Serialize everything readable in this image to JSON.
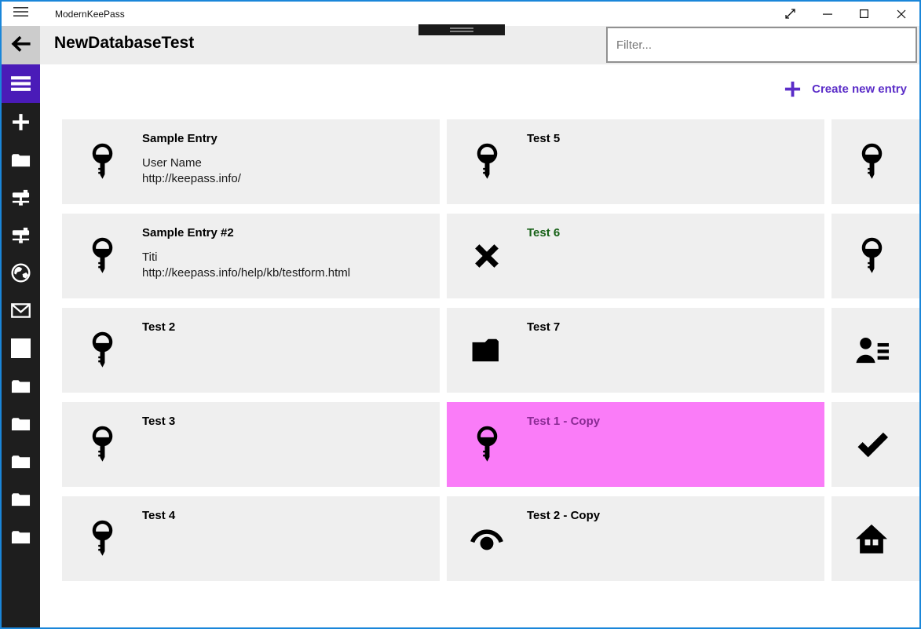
{
  "titlebar": {
    "app_title": "ModernKeePass",
    "menu_icon": "hamburger-thin",
    "controls": [
      {
        "name": "expand",
        "icon": "expand"
      },
      {
        "name": "minimize",
        "icon": "minimize"
      },
      {
        "name": "maximize",
        "icon": "maximize"
      },
      {
        "name": "close",
        "icon": "close"
      }
    ]
  },
  "header": {
    "title": "NewDatabaseTest",
    "back_icon": "back-arrow",
    "filter": {
      "placeholder": "Filter...",
      "value": ""
    }
  },
  "sidebar": {
    "items": [
      {
        "name": "menu",
        "icon": "hamburger",
        "active": true
      },
      {
        "name": "add",
        "icon": "plus"
      },
      {
        "name": "folder",
        "icon": "folder"
      },
      {
        "name": "hierarchy-1",
        "icon": "sitemap"
      },
      {
        "name": "hierarchy-2",
        "icon": "sitemap"
      },
      {
        "name": "internet",
        "icon": "globe"
      },
      {
        "name": "mail",
        "icon": "mail"
      },
      {
        "name": "group-square",
        "icon": "square"
      },
      {
        "name": "group-folder-1",
        "icon": "folder"
      },
      {
        "name": "group-folder-2",
        "icon": "folder"
      },
      {
        "name": "group-folder-3",
        "icon": "folder"
      },
      {
        "name": "group-folder-4",
        "icon": "folder"
      },
      {
        "name": "group-folder-5",
        "icon": "folder"
      }
    ]
  },
  "toolbar": {
    "create_label": "Create new entry",
    "create_icon": "plus"
  },
  "entries": [
    {
      "title": "Sample Entry",
      "details": [
        "User Name",
        "http://keepass.info/"
      ],
      "icon": "key",
      "state": "normal"
    },
    {
      "title": "Test 5",
      "details": [],
      "icon": "key",
      "state": "normal"
    },
    {
      "title": "",
      "details": [],
      "icon": "key",
      "state": "clipped"
    },
    {
      "title": "Sample Entry #2",
      "details": [
        "Titi",
        "http://keepass.info/help/kb/testform.html"
      ],
      "icon": "key",
      "state": "normal"
    },
    {
      "title": "Test 6",
      "details": [],
      "icon": "x-cross",
      "state": "expired"
    },
    {
      "title": "",
      "details": [],
      "icon": "key",
      "state": "clipped"
    },
    {
      "title": "Test 2",
      "details": [],
      "icon": "key",
      "state": "normal"
    },
    {
      "title": "Test 7",
      "details": [],
      "icon": "folder-filled",
      "state": "normal"
    },
    {
      "title": "",
      "details": [],
      "icon": "contact-list",
      "state": "clipped"
    },
    {
      "title": "Test 3",
      "details": [],
      "icon": "key",
      "state": "normal"
    },
    {
      "title": "Test 1 - Copy",
      "details": [],
      "icon": "key",
      "state": "selected"
    },
    {
      "title": "",
      "details": [],
      "icon": "checkmark",
      "state": "clipped"
    },
    {
      "title": "Test 4",
      "details": [],
      "icon": "key",
      "state": "normal"
    },
    {
      "title": "Test 2 - Copy",
      "details": [],
      "icon": "view-eye",
      "state": "normal"
    },
    {
      "title": "",
      "details": [],
      "icon": "home",
      "state": "clipped"
    }
  ],
  "colors": {
    "accent": "#4a1bb8",
    "accent_text": "#5b2dc8",
    "selection_bg": "#fa7cf8",
    "selection_text": "#8a2b94",
    "expired_text": "#176117",
    "card_bg": "#efefef",
    "sidebar_bg": "#1e1e1e",
    "window_border": "#1a86d9"
  }
}
